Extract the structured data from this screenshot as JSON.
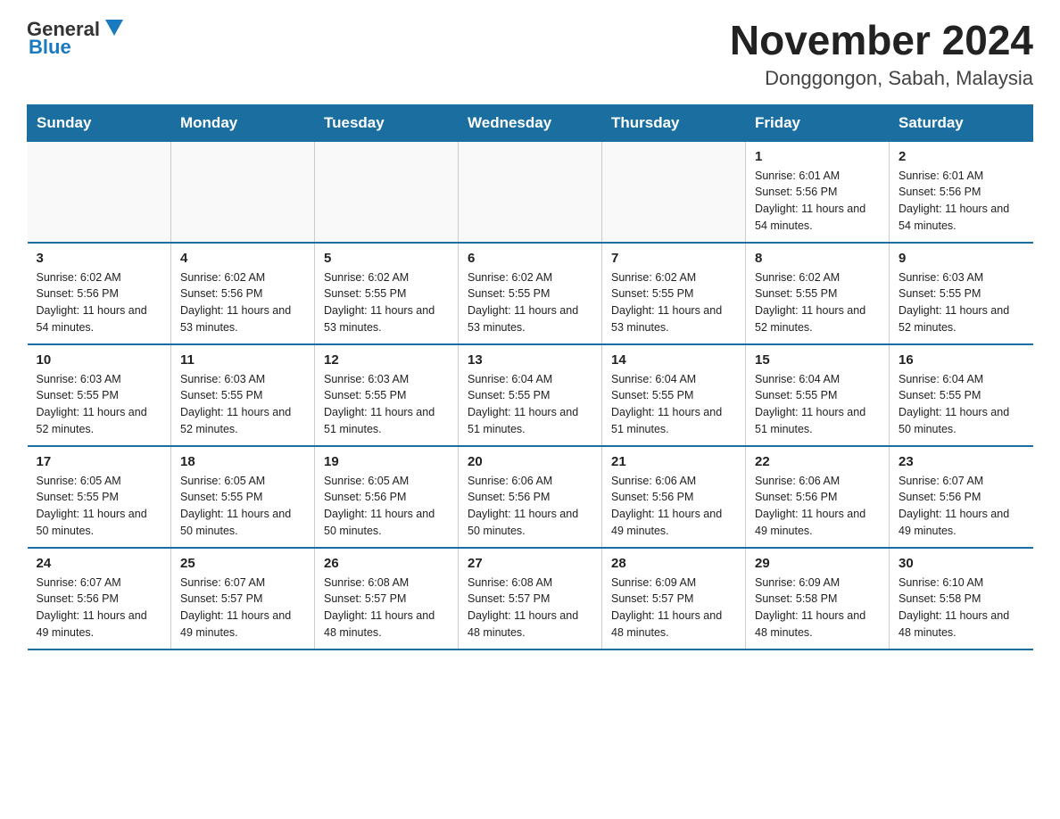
{
  "header": {
    "logo_general": "General",
    "logo_blue": "Blue",
    "month_year": "November 2024",
    "location": "Donggongon, Sabah, Malaysia"
  },
  "days_of_week": [
    "Sunday",
    "Monday",
    "Tuesday",
    "Wednesday",
    "Thursday",
    "Friday",
    "Saturday"
  ],
  "weeks": [
    [
      {
        "day": "",
        "sunrise": "",
        "sunset": "",
        "daylight": "",
        "empty": true
      },
      {
        "day": "",
        "sunrise": "",
        "sunset": "",
        "daylight": "",
        "empty": true
      },
      {
        "day": "",
        "sunrise": "",
        "sunset": "",
        "daylight": "",
        "empty": true
      },
      {
        "day": "",
        "sunrise": "",
        "sunset": "",
        "daylight": "",
        "empty": true
      },
      {
        "day": "",
        "sunrise": "",
        "sunset": "",
        "daylight": "",
        "empty": true
      },
      {
        "day": "1",
        "sunrise": "Sunrise: 6:01 AM",
        "sunset": "Sunset: 5:56 PM",
        "daylight": "Daylight: 11 hours and 54 minutes.",
        "empty": false
      },
      {
        "day": "2",
        "sunrise": "Sunrise: 6:01 AM",
        "sunset": "Sunset: 5:56 PM",
        "daylight": "Daylight: 11 hours and 54 minutes.",
        "empty": false
      }
    ],
    [
      {
        "day": "3",
        "sunrise": "Sunrise: 6:02 AM",
        "sunset": "Sunset: 5:56 PM",
        "daylight": "Daylight: 11 hours and 54 minutes.",
        "empty": false
      },
      {
        "day": "4",
        "sunrise": "Sunrise: 6:02 AM",
        "sunset": "Sunset: 5:56 PM",
        "daylight": "Daylight: 11 hours and 53 minutes.",
        "empty": false
      },
      {
        "day": "5",
        "sunrise": "Sunrise: 6:02 AM",
        "sunset": "Sunset: 5:55 PM",
        "daylight": "Daylight: 11 hours and 53 minutes.",
        "empty": false
      },
      {
        "day": "6",
        "sunrise": "Sunrise: 6:02 AM",
        "sunset": "Sunset: 5:55 PM",
        "daylight": "Daylight: 11 hours and 53 minutes.",
        "empty": false
      },
      {
        "day": "7",
        "sunrise": "Sunrise: 6:02 AM",
        "sunset": "Sunset: 5:55 PM",
        "daylight": "Daylight: 11 hours and 53 minutes.",
        "empty": false
      },
      {
        "day": "8",
        "sunrise": "Sunrise: 6:02 AM",
        "sunset": "Sunset: 5:55 PM",
        "daylight": "Daylight: 11 hours and 52 minutes.",
        "empty": false
      },
      {
        "day": "9",
        "sunrise": "Sunrise: 6:03 AM",
        "sunset": "Sunset: 5:55 PM",
        "daylight": "Daylight: 11 hours and 52 minutes.",
        "empty": false
      }
    ],
    [
      {
        "day": "10",
        "sunrise": "Sunrise: 6:03 AM",
        "sunset": "Sunset: 5:55 PM",
        "daylight": "Daylight: 11 hours and 52 minutes.",
        "empty": false
      },
      {
        "day": "11",
        "sunrise": "Sunrise: 6:03 AM",
        "sunset": "Sunset: 5:55 PM",
        "daylight": "Daylight: 11 hours and 52 minutes.",
        "empty": false
      },
      {
        "day": "12",
        "sunrise": "Sunrise: 6:03 AM",
        "sunset": "Sunset: 5:55 PM",
        "daylight": "Daylight: 11 hours and 51 minutes.",
        "empty": false
      },
      {
        "day": "13",
        "sunrise": "Sunrise: 6:04 AM",
        "sunset": "Sunset: 5:55 PM",
        "daylight": "Daylight: 11 hours and 51 minutes.",
        "empty": false
      },
      {
        "day": "14",
        "sunrise": "Sunrise: 6:04 AM",
        "sunset": "Sunset: 5:55 PM",
        "daylight": "Daylight: 11 hours and 51 minutes.",
        "empty": false
      },
      {
        "day": "15",
        "sunrise": "Sunrise: 6:04 AM",
        "sunset": "Sunset: 5:55 PM",
        "daylight": "Daylight: 11 hours and 51 minutes.",
        "empty": false
      },
      {
        "day": "16",
        "sunrise": "Sunrise: 6:04 AM",
        "sunset": "Sunset: 5:55 PM",
        "daylight": "Daylight: 11 hours and 50 minutes.",
        "empty": false
      }
    ],
    [
      {
        "day": "17",
        "sunrise": "Sunrise: 6:05 AM",
        "sunset": "Sunset: 5:55 PM",
        "daylight": "Daylight: 11 hours and 50 minutes.",
        "empty": false
      },
      {
        "day": "18",
        "sunrise": "Sunrise: 6:05 AM",
        "sunset": "Sunset: 5:55 PM",
        "daylight": "Daylight: 11 hours and 50 minutes.",
        "empty": false
      },
      {
        "day": "19",
        "sunrise": "Sunrise: 6:05 AM",
        "sunset": "Sunset: 5:56 PM",
        "daylight": "Daylight: 11 hours and 50 minutes.",
        "empty": false
      },
      {
        "day": "20",
        "sunrise": "Sunrise: 6:06 AM",
        "sunset": "Sunset: 5:56 PM",
        "daylight": "Daylight: 11 hours and 50 minutes.",
        "empty": false
      },
      {
        "day": "21",
        "sunrise": "Sunrise: 6:06 AM",
        "sunset": "Sunset: 5:56 PM",
        "daylight": "Daylight: 11 hours and 49 minutes.",
        "empty": false
      },
      {
        "day": "22",
        "sunrise": "Sunrise: 6:06 AM",
        "sunset": "Sunset: 5:56 PM",
        "daylight": "Daylight: 11 hours and 49 minutes.",
        "empty": false
      },
      {
        "day": "23",
        "sunrise": "Sunrise: 6:07 AM",
        "sunset": "Sunset: 5:56 PM",
        "daylight": "Daylight: 11 hours and 49 minutes.",
        "empty": false
      }
    ],
    [
      {
        "day": "24",
        "sunrise": "Sunrise: 6:07 AM",
        "sunset": "Sunset: 5:56 PM",
        "daylight": "Daylight: 11 hours and 49 minutes.",
        "empty": false
      },
      {
        "day": "25",
        "sunrise": "Sunrise: 6:07 AM",
        "sunset": "Sunset: 5:57 PM",
        "daylight": "Daylight: 11 hours and 49 minutes.",
        "empty": false
      },
      {
        "day": "26",
        "sunrise": "Sunrise: 6:08 AM",
        "sunset": "Sunset: 5:57 PM",
        "daylight": "Daylight: 11 hours and 48 minutes.",
        "empty": false
      },
      {
        "day": "27",
        "sunrise": "Sunrise: 6:08 AM",
        "sunset": "Sunset: 5:57 PM",
        "daylight": "Daylight: 11 hours and 48 minutes.",
        "empty": false
      },
      {
        "day": "28",
        "sunrise": "Sunrise: 6:09 AM",
        "sunset": "Sunset: 5:57 PM",
        "daylight": "Daylight: 11 hours and 48 minutes.",
        "empty": false
      },
      {
        "day": "29",
        "sunrise": "Sunrise: 6:09 AM",
        "sunset": "Sunset: 5:58 PM",
        "daylight": "Daylight: 11 hours and 48 minutes.",
        "empty": false
      },
      {
        "day": "30",
        "sunrise": "Sunrise: 6:10 AM",
        "sunset": "Sunset: 5:58 PM",
        "daylight": "Daylight: 11 hours and 48 minutes.",
        "empty": false
      }
    ]
  ]
}
